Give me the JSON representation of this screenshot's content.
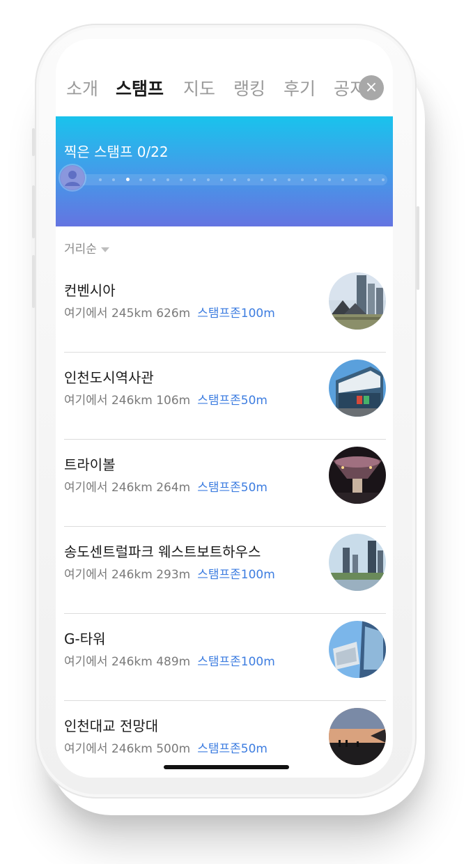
{
  "tabs": [
    {
      "label": "소개",
      "active": false
    },
    {
      "label": "스탬프",
      "active": true
    },
    {
      "label": "지도",
      "active": false
    },
    {
      "label": "랭킹",
      "active": false
    },
    {
      "label": "후기",
      "active": false
    },
    {
      "label": "공지",
      "active": false
    }
  ],
  "close_icon": "×",
  "banner": {
    "title": "찍은 스탬프 0/22",
    "collected": 0,
    "total": 22,
    "gradient_colors": [
      "#19c3ec",
      "#6474e1"
    ]
  },
  "sort": {
    "label": "거리순"
  },
  "accent_color": "#3d7de0",
  "places": [
    {
      "name": "컨벤시아",
      "distance": "여기에서 245km 626m",
      "zone": "스탬프존100m",
      "thumb": "convensia-photo"
    },
    {
      "name": "인천도시역사관",
      "distance": "여기에서 246km 106m",
      "zone": "스탬프존50m",
      "thumb": "museum-photo"
    },
    {
      "name": "트라이볼",
      "distance": "여기에서 246km 264m",
      "zone": "스탬프존50m",
      "thumb": "tribowl-photo"
    },
    {
      "name": "송도센트럴파크 웨스트보트하우스",
      "distance": "여기에서 246km 293m",
      "zone": "스탬프존100m",
      "thumb": "boathouse-photo"
    },
    {
      "name": "G-타워",
      "distance": "여기에서 246km 489m",
      "zone": "스탬프존100m",
      "thumb": "gtower-photo"
    },
    {
      "name": "인천대교 전망대",
      "distance": "여기에서 246km 500m",
      "zone": "스탬프존50m",
      "thumb": "observatory-photo"
    }
  ]
}
